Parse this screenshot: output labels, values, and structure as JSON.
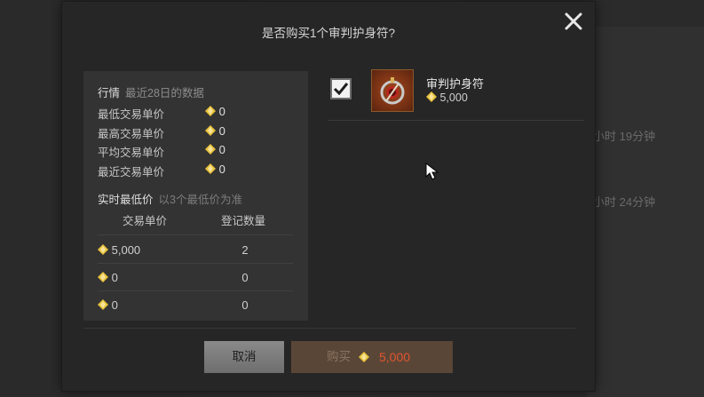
{
  "dialog": {
    "title": "是否购买1个审判护身符?"
  },
  "market": {
    "heading": "行情",
    "heading_sub": "最近28日的数据",
    "stats": [
      {
        "label": "最低交易单价",
        "value": "0"
      },
      {
        "label": "最高交易单价",
        "value": "0"
      },
      {
        "label": "平均交易单价",
        "value": "0"
      },
      {
        "label": "最近交易单价",
        "value": "0"
      }
    ],
    "realtime_heading": "实时最低价",
    "realtime_sub": "以3个最低价为准",
    "columns": [
      "交易单价",
      "登记数量"
    ],
    "rows": [
      {
        "price": "5,000",
        "qty": "2"
      },
      {
        "price": "0",
        "qty": "0"
      },
      {
        "price": "0",
        "qty": "0"
      }
    ]
  },
  "item": {
    "name": "审判护身符",
    "price": "5,000",
    "checked": true
  },
  "buttons": {
    "cancel_label": "取消",
    "buy_label": "购买",
    "buy_amount": "5,000"
  },
  "background": {
    "right_texts": [
      "小时 19分钟",
      "小时 24分钟"
    ]
  },
  "colors": {
    "gem": "#e8c23a",
    "buy_amount": "#e0552f"
  },
  "icons": [
    "close-icon",
    "gem-icon",
    "checkbox-check-icon",
    "amulet-icon",
    "mouse-cursor-icon"
  ]
}
